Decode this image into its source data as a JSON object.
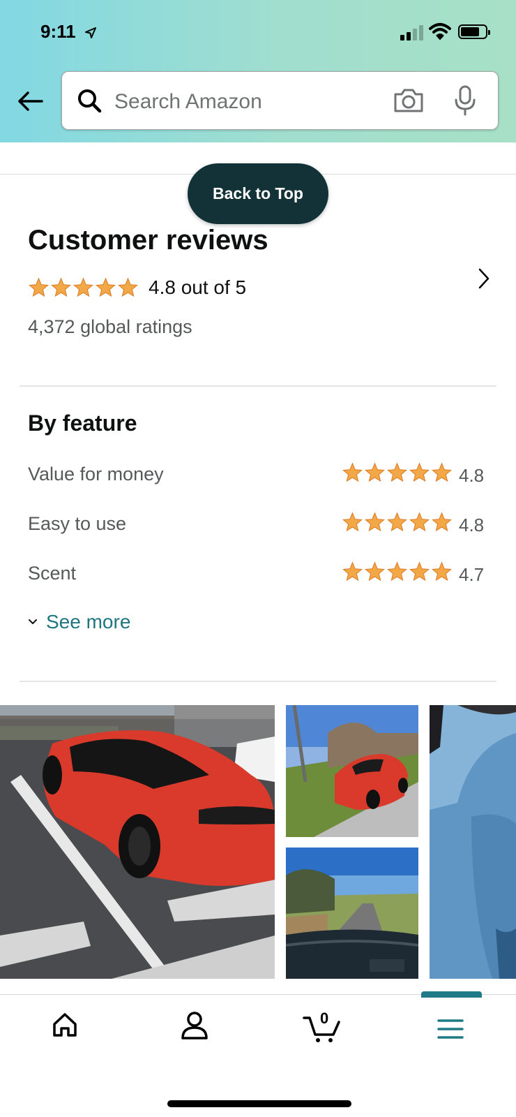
{
  "status_bar": {
    "time": "9:11"
  },
  "search": {
    "placeholder": "Search Amazon"
  },
  "back_to_top": "Back to Top",
  "reviews": {
    "title": "Customer reviews",
    "stars": 4.8,
    "rating_text": "4.8 out of 5",
    "global_ratings": "4,372 global ratings"
  },
  "by_feature": {
    "title": "By feature",
    "items": [
      {
        "name": "Value for money",
        "value": "4.8"
      },
      {
        "name": "Easy to use",
        "value": "4.8"
      },
      {
        "name": "Scent",
        "value": "4.7"
      }
    ],
    "see_more": "See more"
  },
  "photos": [
    {
      "name": "red-car-parking-lot"
    },
    {
      "name": "red-car-on-grass"
    },
    {
      "name": "dashboard-road-view"
    },
    {
      "name": "blue-car-closeup"
    }
  ],
  "bottom_nav": {
    "items": [
      "home",
      "account",
      "cart",
      "menu"
    ],
    "cart_count": "0",
    "active": "menu"
  },
  "colors": {
    "star": "#f3a847",
    "link": "#1f7582",
    "back_to_top_bg": "#133238",
    "header_gradient_start": "#82d8e3",
    "header_gradient_end": "#a7e0c6",
    "nav_active": "#1f7a86"
  }
}
